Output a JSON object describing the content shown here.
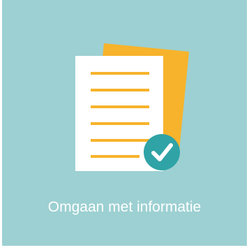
{
  "tile": {
    "label": "Omgaan met informatie",
    "icon": "documents-check-icon",
    "colors": {
      "background": "#9dd0d2",
      "back_sheet": "#f7b32b",
      "front_sheet": "#ffffff",
      "lines": "#f7b32b",
      "check_badge": "#2fa3a6",
      "check_mark": "#ffffff",
      "label_text": "#ffffff"
    }
  }
}
